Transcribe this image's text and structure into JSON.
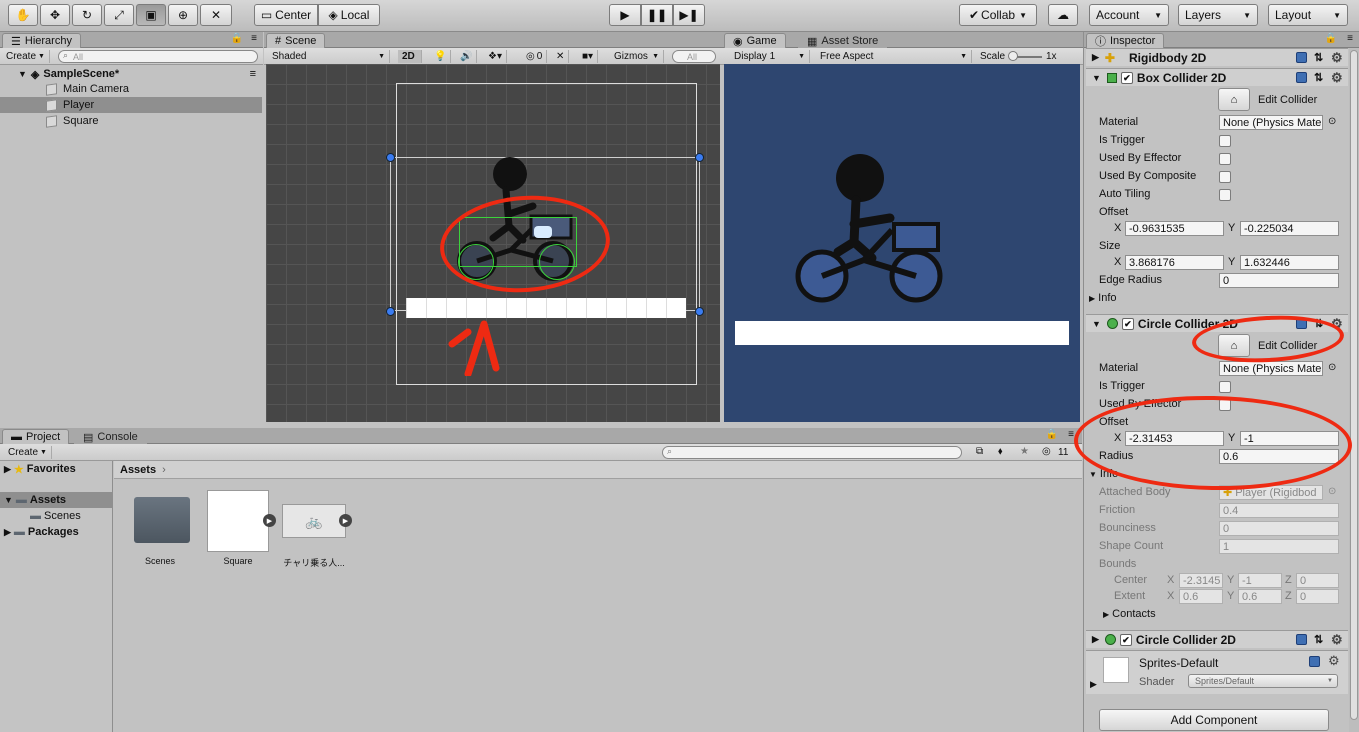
{
  "toolbar": {
    "pivot": "Center",
    "space": "Local",
    "collab": "Collab",
    "account": "Account",
    "layers": "Layers",
    "layout": "Layout"
  },
  "hierarchy": {
    "tab": "Hierarchy",
    "create": "Create",
    "search_placeholder": "All",
    "scene": "SampleScene*",
    "items": [
      "Main Camera",
      "Player",
      "Square"
    ]
  },
  "scene_view": {
    "tab": "Scene",
    "shading": "Shaded",
    "mode_2d": "2D",
    "effects_count": "0",
    "gizmos": "Gizmos",
    "search_placeholder": "All"
  },
  "game_view": {
    "tab": "Game",
    "asset_store_tab": "Asset Store",
    "display": "Display 1",
    "aspect": "Free Aspect",
    "scale_label": "Scale",
    "scale_value": "1x"
  },
  "project": {
    "tab": "Project",
    "console_tab": "Console",
    "create": "Create",
    "favorites": "Favorites",
    "assets": "Assets",
    "scenes": "Scenes",
    "packages": "Packages",
    "breadcrumb": "Assets",
    "hidden_count": "11",
    "items": [
      "Scenes",
      "Square",
      "チャリ乗る人..."
    ]
  },
  "inspector": {
    "tab": "Inspector",
    "rigidbody": "Rigidbody 2D",
    "box_collider": {
      "title": "Box Collider 2D",
      "edit": "Edit Collider",
      "material_label": "Material",
      "material": "None (Physics Mate",
      "is_trigger": "Is Trigger",
      "used_by_effector": "Used By Effector",
      "used_by_composite": "Used By Composite",
      "auto_tiling": "Auto Tiling",
      "offset": "Offset",
      "offset_x": "-0.9631535",
      "offset_y": "-0.225034",
      "size": "Size",
      "size_x": "3.868176",
      "size_y": "1.632446",
      "edge_radius": "Edge Radius",
      "edge_radius_val": "0",
      "info": "Info"
    },
    "circle_collider": {
      "title": "Circle Collider 2D",
      "edit": "Edit Collider",
      "material_label": "Material",
      "material": "None (Physics Mate",
      "is_trigger": "Is Trigger",
      "used_by_effector": "Used By Effector",
      "offset": "Offset",
      "offset_x": "-2.31453",
      "offset_y": "-1",
      "radius": "Radius",
      "radius_val": "0.6",
      "info": "Info",
      "attached_body": "Attached Body",
      "attached_body_val": "Player (Rigidbod",
      "friction": "Friction",
      "friction_val": "0.4",
      "bounciness": "Bounciness",
      "bounciness_val": "0",
      "shape_count": "Shape Count",
      "shape_count_val": "1",
      "bounds": "Bounds",
      "center": "Center",
      "center_x": "-2.3145",
      "center_y": "-1",
      "center_z": "0",
      "extent": "Extent",
      "extent_x": "0.6",
      "extent_y": "0.6",
      "extent_z": "0",
      "contacts": "Contacts"
    },
    "circle_collider_2": "Circle Collider 2D",
    "material": {
      "name": "Sprites-Default",
      "shader_label": "Shader",
      "shader": "Sprites/Default"
    },
    "add_component": "Add Component",
    "axis": {
      "x": "X",
      "y": "Y",
      "z": "Z"
    }
  },
  "colors": {
    "annotation": "#ee2a12",
    "game_background": "#2e4670",
    "scene_background": "#464646"
  }
}
